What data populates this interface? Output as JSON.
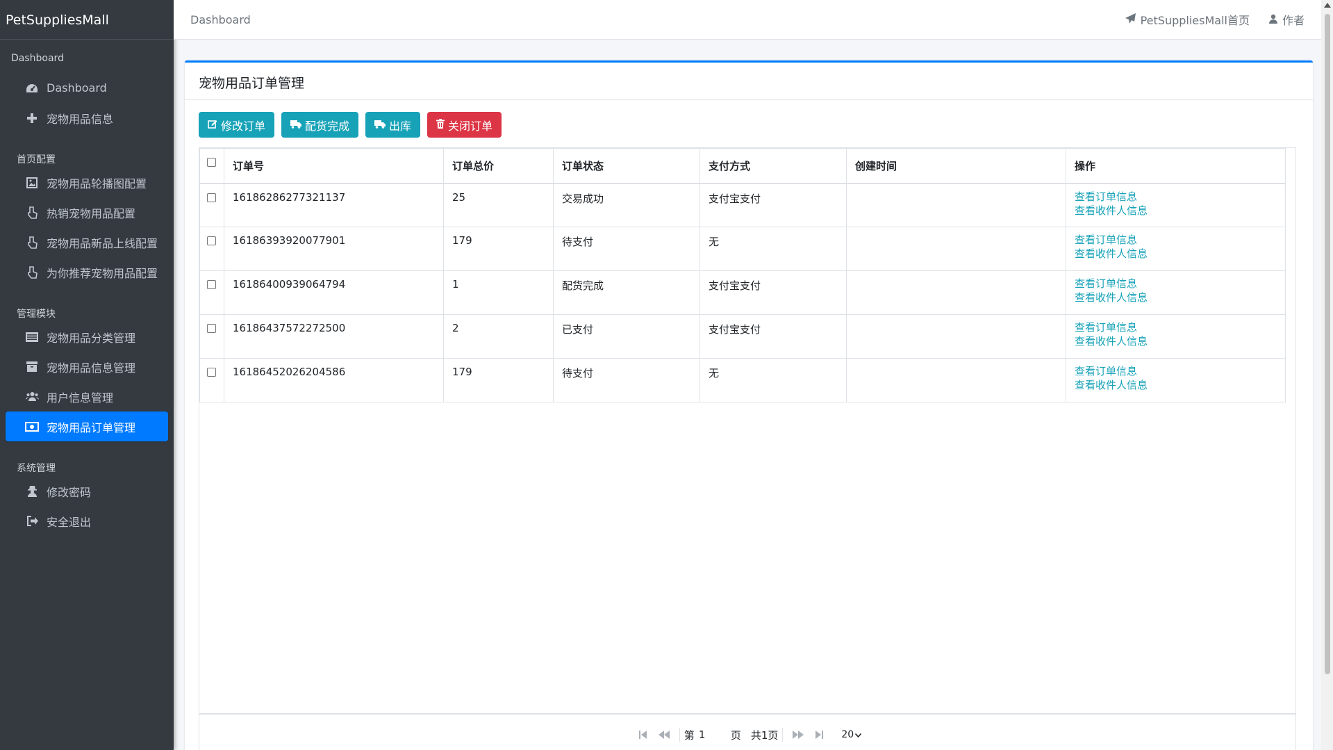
{
  "brand": "PetSuppliesMall",
  "sidebar": {
    "sections": [
      {
        "header": "Dashboard",
        "items": [
          {
            "label": "Dashboard",
            "icon": "dashboard-icon"
          },
          {
            "label": "宠物用品信息",
            "icon": "plus-icon"
          }
        ]
      },
      {
        "header": "首页配置",
        "items": [
          {
            "label": "宠物用品轮播图配置",
            "icon": "image-icon"
          },
          {
            "label": "热销宠物用品配置",
            "icon": "hand-pointer-icon"
          },
          {
            "label": "宠物用品新品上线配置",
            "icon": "hand-pointer-icon"
          },
          {
            "label": "为你推荐宠物用品配置",
            "icon": "hand-pointer-icon"
          }
        ]
      },
      {
        "header": "管理模块",
        "items": [
          {
            "label": "宠物用品分类管理",
            "icon": "list-icon"
          },
          {
            "label": "宠物用品信息管理",
            "icon": "archive-icon"
          },
          {
            "label": "用户信息管理",
            "icon": "users-icon"
          },
          {
            "label": "宠物用品订单管理",
            "icon": "money-icon",
            "active": true
          }
        ]
      },
      {
        "header": "系统管理",
        "items": [
          {
            "label": "修改密码",
            "icon": "user-secret-icon"
          },
          {
            "label": "安全退出",
            "icon": "sign-out-icon"
          }
        ]
      }
    ]
  },
  "topbar": {
    "breadcrumb": "Dashboard",
    "home_link": "PetSuppliesMall首页",
    "author_link": "作者"
  },
  "card": {
    "title": "宠物用品订单管理",
    "buttons": {
      "edit": "修改订单",
      "packed": "配货完成",
      "outbound": "出库",
      "close": "关闭订单"
    }
  },
  "table": {
    "headers": [
      "订单号",
      "订单总价",
      "订单状态",
      "支付方式",
      "创建时间",
      "操作"
    ],
    "rows": [
      {
        "order_no": "16186286277321137",
        "total": "25",
        "status": "交易成功",
        "pay": "支付宝支付",
        "created": ""
      },
      {
        "order_no": "16186393920077901",
        "total": "179",
        "status": "待支付",
        "pay": "无",
        "created": ""
      },
      {
        "order_no": "16186400939064794",
        "total": "1",
        "status": "配货完成",
        "pay": "支付宝支付",
        "created": ""
      },
      {
        "order_no": "16186437572272500",
        "total": "2",
        "status": "已支付",
        "pay": "支付宝支付",
        "created": ""
      },
      {
        "order_no": "16186452026204586",
        "total": "179",
        "status": "待支付",
        "pay": "无",
        "created": ""
      }
    ],
    "action_order": "查看订单信息",
    "action_receiver": "查看收件人信息"
  },
  "pager": {
    "page_prefix": "第",
    "page_value": "1",
    "page_suffix": "页",
    "total": "共1页",
    "page_size": "20"
  }
}
